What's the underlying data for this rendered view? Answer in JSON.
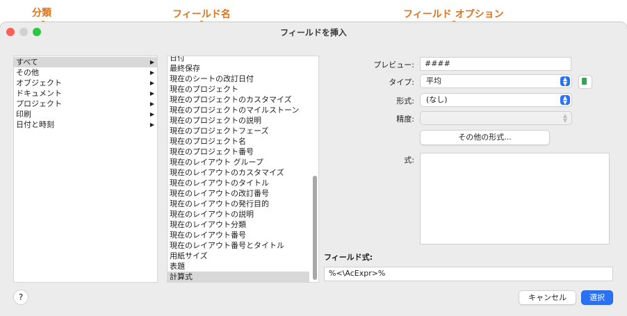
{
  "annotations": {
    "category": "分類",
    "field_names": "フィールド名",
    "field_options": "フィールド オプション"
  },
  "colors": {
    "annotation": "#e0741b",
    "accent": "#2a72f5"
  },
  "window": {
    "title": "フィールドを挿入"
  },
  "categories": {
    "items": [
      {
        "label": "すべて"
      },
      {
        "label": "その他"
      },
      {
        "label": "オブジェクト"
      },
      {
        "label": "ドキュメント"
      },
      {
        "label": "プロジェクト"
      },
      {
        "label": "印刷"
      },
      {
        "label": "日付と時刻"
      }
    ],
    "selected": "すべて",
    "arrow_icon": "▶"
  },
  "fields": {
    "items": [
      {
        "label": "日付"
      },
      {
        "label": "最終保存"
      },
      {
        "label": "現在のシートの改訂日付"
      },
      {
        "label": "現在のプロジェクト"
      },
      {
        "label": "現在のプロジェクトのカスタマイズ"
      },
      {
        "label": "現在のプロジェクトのマイルストーン"
      },
      {
        "label": "現在のプロジェクトの説明"
      },
      {
        "label": "現在のプロジェクトフェーズ"
      },
      {
        "label": "現在のプロジェクト名"
      },
      {
        "label": "現在のプロジェクト番号"
      },
      {
        "label": "現在のレイアウト グループ"
      },
      {
        "label": "現在のレイアウトのカスタマイズ"
      },
      {
        "label": "現在のレイアウトのタイトル"
      },
      {
        "label": "現在のレイアウトの改訂番号"
      },
      {
        "label": "現在のレイアウトの発行目的"
      },
      {
        "label": "現在のレイアウトの説明"
      },
      {
        "label": "現在のレイアウト分類"
      },
      {
        "label": "現在のレイアウト番号"
      },
      {
        "label": "現在のレイアウト番号とタイトル"
      },
      {
        "label": "用紙サイズ"
      },
      {
        "label": "表題"
      },
      {
        "label": "計算式"
      }
    ],
    "selected": "計算式"
  },
  "options": {
    "preview_label": "プレビュー:",
    "preview_value": "####",
    "type_label": "タイプ:",
    "type_value": "平均",
    "format_label": "形式:",
    "format_value": "(なし)",
    "precision_label": "精度:",
    "precision_value": "",
    "other_formats_button": "その他の形式...",
    "expression_label": "式:",
    "expression_value": ""
  },
  "field_expression": {
    "label": "フィールド式:",
    "value": "%<\\AcExpr>%"
  },
  "buttons": {
    "help": "?",
    "cancel": "キャンセル",
    "select": "選択"
  }
}
